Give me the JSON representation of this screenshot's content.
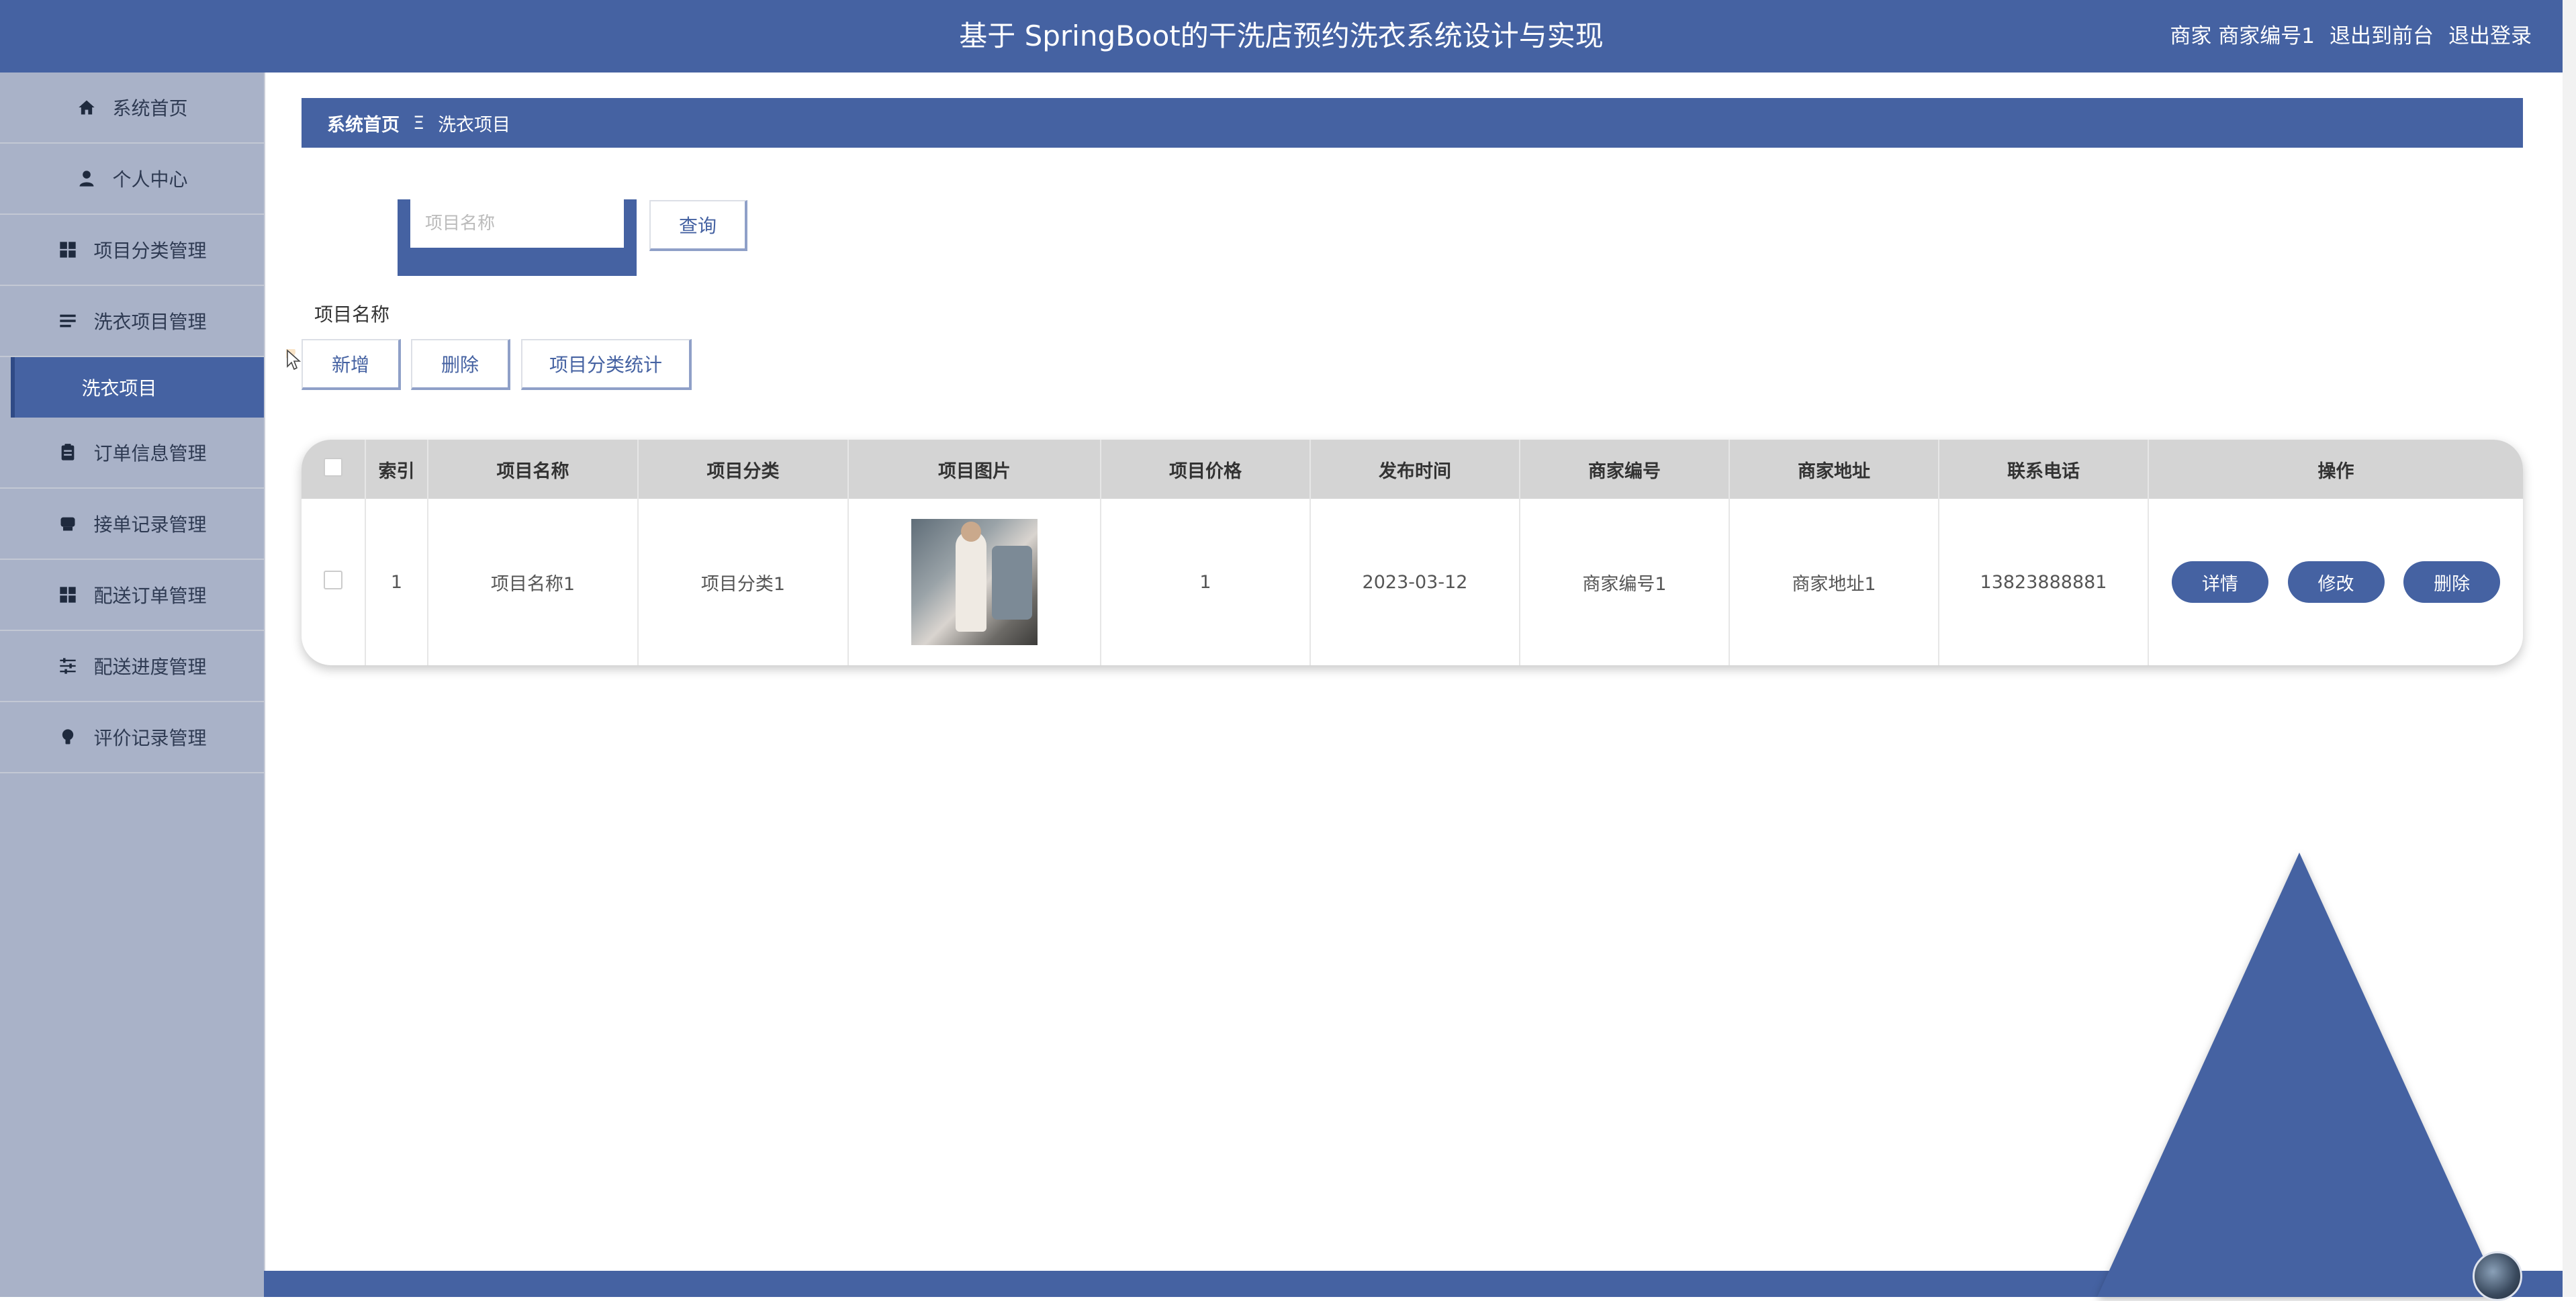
{
  "header": {
    "title": "基于 SpringBoot的干洗店预约洗衣系统设计与实现",
    "user_text": "商家 商家编号1",
    "to_front": "退出到前台",
    "logout": "退出登录"
  },
  "sidebar": {
    "items": [
      {
        "label": "系统首页",
        "icon": "home-icon"
      },
      {
        "label": "个人中心",
        "icon": "user-icon"
      },
      {
        "label": "项目分类管理",
        "icon": "grid-icon"
      },
      {
        "label": "洗衣项目管理",
        "icon": "list-icon"
      },
      {
        "label": "洗衣项目",
        "icon": ""
      },
      {
        "label": "订单信息管理",
        "icon": "clipboard-icon"
      },
      {
        "label": "接单记录管理",
        "icon": "printer-icon"
      },
      {
        "label": "配送订单管理",
        "icon": "grid-icon"
      },
      {
        "label": "配送进度管理",
        "icon": "sliders-icon"
      },
      {
        "label": "评价记录管理",
        "icon": "bulb-icon"
      }
    ]
  },
  "breadcrumb": {
    "home": "系统首页",
    "separator": "Ξ",
    "current": "洗衣项目"
  },
  "search": {
    "label": "项目名称",
    "placeholder": "项目名称",
    "value": "",
    "button": "查询"
  },
  "toolbar": {
    "add": "新增",
    "delete": "删除",
    "stats": "项目分类统计"
  },
  "table": {
    "columns": [
      "索引",
      "项目名称",
      "项目分类",
      "项目图片",
      "项目价格",
      "发布时间",
      "商家编号",
      "商家地址",
      "联系电话",
      "操作"
    ],
    "rows": [
      {
        "index": "1",
        "name": "项目名称1",
        "category": "项目分类1",
        "price": "1",
        "published": "2023-03-12",
        "merchant_no": "商家编号1",
        "merchant_addr": "商家地址1",
        "phone": "13823888881"
      }
    ],
    "actions": {
      "detail": "详情",
      "edit": "修改",
      "delete": "删除"
    }
  },
  "colors": {
    "primary": "#4562a2",
    "sidebar_bg": "#a9b2c8",
    "table_header_bg": "#d4d4d4"
  }
}
